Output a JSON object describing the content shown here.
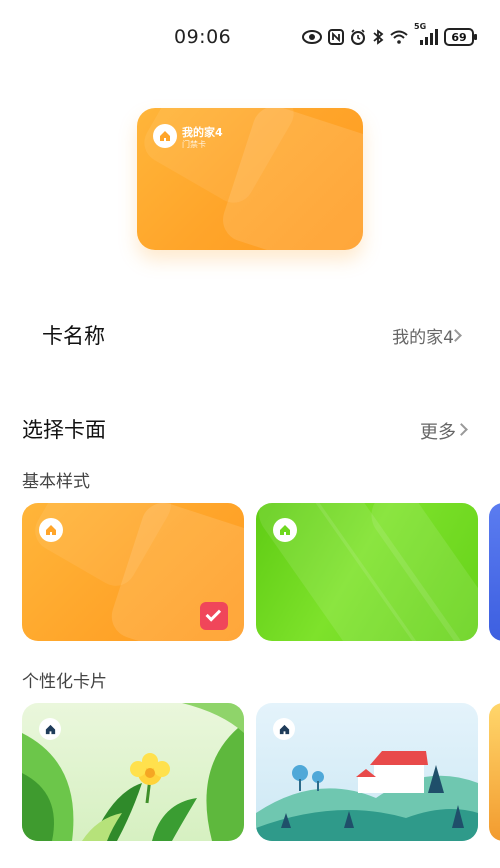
{
  "status_bar": {
    "time": "09:06",
    "network": "5G",
    "battery": "69",
    "icons": [
      "eye-icon",
      "nfc-icon",
      "alarm-icon",
      "bluetooth-icon",
      "wifi-icon",
      "signal-icon",
      "battery-icon"
    ]
  },
  "preview_card": {
    "name": "我的家4",
    "type": "门禁卡",
    "icon": "home-icon"
  },
  "card_name_row": {
    "label": "卡名称",
    "value": "我的家4"
  },
  "card_face": {
    "title": "选择卡面",
    "more": "更多",
    "basic_section": "基本样式",
    "personal_section": "个性化卡片",
    "basic_options": [
      {
        "style": "orange",
        "selected": true,
        "icon": "home-icon"
      },
      {
        "style": "green",
        "selected": false,
        "icon": "home-icon"
      },
      {
        "style": "blue",
        "selected": false
      }
    ],
    "personal_options": [
      {
        "style": "flower",
        "icon": "home-icon"
      },
      {
        "style": "house-landscape",
        "icon": "home-icon"
      },
      {
        "style": "sunset"
      }
    ]
  },
  "colors": {
    "accent_orange": "#ffa52a",
    "accent_green": "#6fd81f",
    "check_red": "#f0465a",
    "text_secondary": "#666666"
  }
}
